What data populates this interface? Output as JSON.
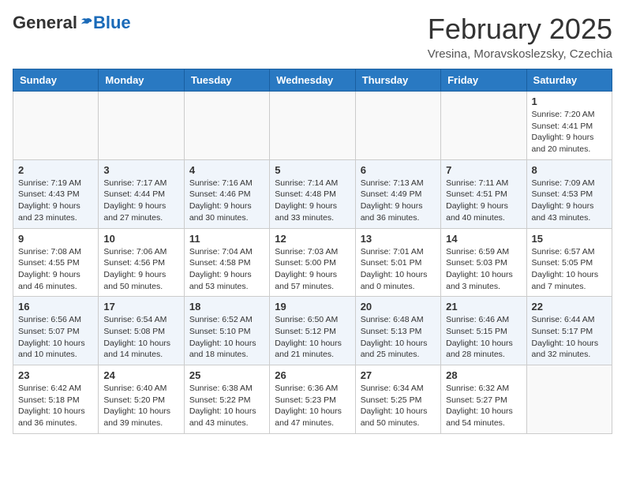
{
  "header": {
    "logo_general": "General",
    "logo_blue": "Blue",
    "month_title": "February 2025",
    "location": "Vresina, Moravskoslezsky, Czechia"
  },
  "days_of_week": [
    "Sunday",
    "Monday",
    "Tuesday",
    "Wednesday",
    "Thursday",
    "Friday",
    "Saturday"
  ],
  "weeks": [
    [
      {
        "num": "",
        "info": ""
      },
      {
        "num": "",
        "info": ""
      },
      {
        "num": "",
        "info": ""
      },
      {
        "num": "",
        "info": ""
      },
      {
        "num": "",
        "info": ""
      },
      {
        "num": "",
        "info": ""
      },
      {
        "num": "1",
        "info": "Sunrise: 7:20 AM\nSunset: 4:41 PM\nDaylight: 9 hours and 20 minutes."
      }
    ],
    [
      {
        "num": "2",
        "info": "Sunrise: 7:19 AM\nSunset: 4:43 PM\nDaylight: 9 hours and 23 minutes."
      },
      {
        "num": "3",
        "info": "Sunrise: 7:17 AM\nSunset: 4:44 PM\nDaylight: 9 hours and 27 minutes."
      },
      {
        "num": "4",
        "info": "Sunrise: 7:16 AM\nSunset: 4:46 PM\nDaylight: 9 hours and 30 minutes."
      },
      {
        "num": "5",
        "info": "Sunrise: 7:14 AM\nSunset: 4:48 PM\nDaylight: 9 hours and 33 minutes."
      },
      {
        "num": "6",
        "info": "Sunrise: 7:13 AM\nSunset: 4:49 PM\nDaylight: 9 hours and 36 minutes."
      },
      {
        "num": "7",
        "info": "Sunrise: 7:11 AM\nSunset: 4:51 PM\nDaylight: 9 hours and 40 minutes."
      },
      {
        "num": "8",
        "info": "Sunrise: 7:09 AM\nSunset: 4:53 PM\nDaylight: 9 hours and 43 minutes."
      }
    ],
    [
      {
        "num": "9",
        "info": "Sunrise: 7:08 AM\nSunset: 4:55 PM\nDaylight: 9 hours and 46 minutes."
      },
      {
        "num": "10",
        "info": "Sunrise: 7:06 AM\nSunset: 4:56 PM\nDaylight: 9 hours and 50 minutes."
      },
      {
        "num": "11",
        "info": "Sunrise: 7:04 AM\nSunset: 4:58 PM\nDaylight: 9 hours and 53 minutes."
      },
      {
        "num": "12",
        "info": "Sunrise: 7:03 AM\nSunset: 5:00 PM\nDaylight: 9 hours and 57 minutes."
      },
      {
        "num": "13",
        "info": "Sunrise: 7:01 AM\nSunset: 5:01 PM\nDaylight: 10 hours and 0 minutes."
      },
      {
        "num": "14",
        "info": "Sunrise: 6:59 AM\nSunset: 5:03 PM\nDaylight: 10 hours and 3 minutes."
      },
      {
        "num": "15",
        "info": "Sunrise: 6:57 AM\nSunset: 5:05 PM\nDaylight: 10 hours and 7 minutes."
      }
    ],
    [
      {
        "num": "16",
        "info": "Sunrise: 6:56 AM\nSunset: 5:07 PM\nDaylight: 10 hours and 10 minutes."
      },
      {
        "num": "17",
        "info": "Sunrise: 6:54 AM\nSunset: 5:08 PM\nDaylight: 10 hours and 14 minutes."
      },
      {
        "num": "18",
        "info": "Sunrise: 6:52 AM\nSunset: 5:10 PM\nDaylight: 10 hours and 18 minutes."
      },
      {
        "num": "19",
        "info": "Sunrise: 6:50 AM\nSunset: 5:12 PM\nDaylight: 10 hours and 21 minutes."
      },
      {
        "num": "20",
        "info": "Sunrise: 6:48 AM\nSunset: 5:13 PM\nDaylight: 10 hours and 25 minutes."
      },
      {
        "num": "21",
        "info": "Sunrise: 6:46 AM\nSunset: 5:15 PM\nDaylight: 10 hours and 28 minutes."
      },
      {
        "num": "22",
        "info": "Sunrise: 6:44 AM\nSunset: 5:17 PM\nDaylight: 10 hours and 32 minutes."
      }
    ],
    [
      {
        "num": "23",
        "info": "Sunrise: 6:42 AM\nSunset: 5:18 PM\nDaylight: 10 hours and 36 minutes."
      },
      {
        "num": "24",
        "info": "Sunrise: 6:40 AM\nSunset: 5:20 PM\nDaylight: 10 hours and 39 minutes."
      },
      {
        "num": "25",
        "info": "Sunrise: 6:38 AM\nSunset: 5:22 PM\nDaylight: 10 hours and 43 minutes."
      },
      {
        "num": "26",
        "info": "Sunrise: 6:36 AM\nSunset: 5:23 PM\nDaylight: 10 hours and 47 minutes."
      },
      {
        "num": "27",
        "info": "Sunrise: 6:34 AM\nSunset: 5:25 PM\nDaylight: 10 hours and 50 minutes."
      },
      {
        "num": "28",
        "info": "Sunrise: 6:32 AM\nSunset: 5:27 PM\nDaylight: 10 hours and 54 minutes."
      },
      {
        "num": "",
        "info": ""
      }
    ]
  ]
}
